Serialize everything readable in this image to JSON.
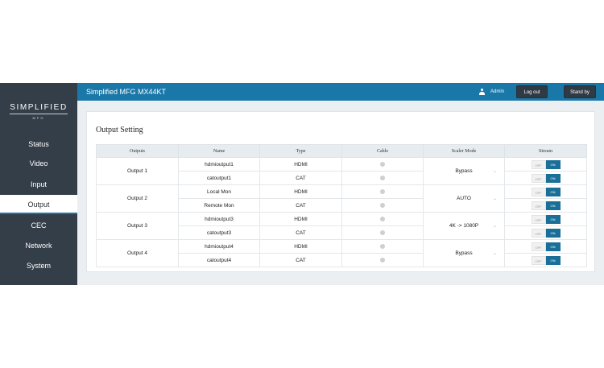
{
  "brand": {
    "logo_main": "SIMPLIFIED",
    "logo_sub": "MFG"
  },
  "sidebar": {
    "items": [
      {
        "label": "Status",
        "active": false
      },
      {
        "label": "Video",
        "active": false
      },
      {
        "label": "Input",
        "active": false
      },
      {
        "label": "Output",
        "active": true
      },
      {
        "label": "CEC",
        "active": false
      },
      {
        "label": "Network",
        "active": false
      },
      {
        "label": "System",
        "active": false
      }
    ]
  },
  "header": {
    "title": "Simplified MFG MX44KT",
    "user": "Admin",
    "logout_label": "Log out",
    "standby_label": "Stand by"
  },
  "main": {
    "section_title": "Output Setting",
    "columns": [
      "Outputs",
      "Name",
      "Type",
      "Cable",
      "Scaler Mode",
      "Stream"
    ],
    "outputs": [
      {
        "label": "Output 1",
        "scaler": "Bypass",
        "rows": [
          {
            "name": "hdmioutput1",
            "type": "HDMI",
            "stream": "ON"
          },
          {
            "name": "catoutput1",
            "type": "CAT",
            "stream": "ON"
          }
        ]
      },
      {
        "label": "Output 2",
        "scaler": "AUTO",
        "rows": [
          {
            "name": "Local Mon",
            "type": "HDMI",
            "stream": "ON"
          },
          {
            "name": "Remote Mon",
            "type": "CAT",
            "stream": "ON"
          }
        ]
      },
      {
        "label": "Output 3",
        "scaler": "4K -> 1080P",
        "rows": [
          {
            "name": "hdmioutput3",
            "type": "HDMI",
            "stream": "ON"
          },
          {
            "name": "catoutput3",
            "type": "CAT",
            "stream": "ON"
          }
        ]
      },
      {
        "label": "Output 4",
        "scaler": "Bypass",
        "rows": [
          {
            "name": "hdmioutput4",
            "type": "HDMI",
            "stream": "ON"
          },
          {
            "name": "catoutput4",
            "type": "CAT",
            "stream": "ON"
          }
        ]
      }
    ],
    "toggle_off": "OFF",
    "toggle_on": "ON"
  },
  "colors": {
    "accent": "#1a78a9",
    "sidebar": "#343e48",
    "background": "#eceff2"
  }
}
